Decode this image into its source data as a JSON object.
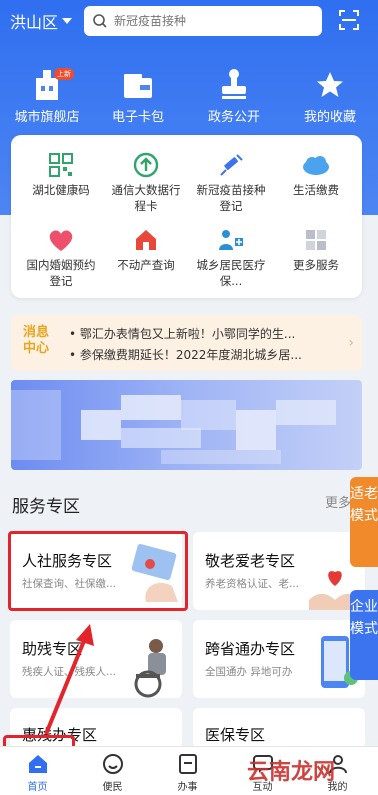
{
  "location": "洪山区",
  "search": {
    "placeholder": "新冠疫苗接种"
  },
  "quick": [
    {
      "label": "城市旗舰店",
      "badge": "上新",
      "icon": "building-icon"
    },
    {
      "label": "电子卡包",
      "icon": "card-wallet-icon"
    },
    {
      "label": "政务公开",
      "icon": "stamp-icon"
    },
    {
      "label": "我的收藏",
      "icon": "star-icon"
    }
  ],
  "services": [
    {
      "label": "湖北健康码",
      "icon": "qr-code-icon"
    },
    {
      "label": "通信大数据行程卡",
      "icon": "arrow-up-circle-icon"
    },
    {
      "label": "新冠疫苗接种登记",
      "icon": "syringe-icon"
    },
    {
      "label": "生活缴费",
      "icon": "cloud-icon"
    },
    {
      "label": "国内婚姻预约登记",
      "icon": "heart-icon"
    },
    {
      "label": "不动产查询",
      "icon": "house-icon"
    },
    {
      "label": "城乡居民医疗保...",
      "icon": "medical-person-icon"
    },
    {
      "label": "更多服务",
      "icon": "grid-icon"
    }
  ],
  "news": {
    "logo_top": "消息",
    "logo_bottom": "中心",
    "items": [
      "• 鄂汇办表情包又上新啦！小鄂同学的生...",
      "• 参保缴费期延长！2022年度湖北城乡居..."
    ]
  },
  "section": {
    "title": "服务专区",
    "more": "更多"
  },
  "tiles": [
    {
      "title": "人社服务专区",
      "sub": "社保查询、社保缴..."
    },
    {
      "title": "敬老爱老专区",
      "sub": "养老资格认证、老..."
    },
    {
      "title": "助残专区",
      "sub": "残疾人证、残疾人..."
    },
    {
      "title": "跨省通办专区",
      "sub": "全国通办  异地可办"
    },
    {
      "title": "惠残办专区",
      "sub": ""
    },
    {
      "title": "医保专区",
      "sub": ""
    }
  ],
  "side": {
    "elder": "适老模式",
    "enterprise": "企业模式"
  },
  "tabs": [
    {
      "label": "首页",
      "icon": "home-icon"
    },
    {
      "label": "便民",
      "icon": "smile-icon"
    },
    {
      "label": "办事",
      "icon": "document-icon"
    },
    {
      "label": "互动",
      "icon": "chat-icon"
    },
    {
      "label": "我的",
      "icon": "user-icon"
    }
  ],
  "watermark": "云南龙网",
  "colors": {
    "primary": "#2f6ff0",
    "highlight": "#e4242b",
    "side_orange": "#f08a2b",
    "side_blue": "#3c74f0"
  }
}
